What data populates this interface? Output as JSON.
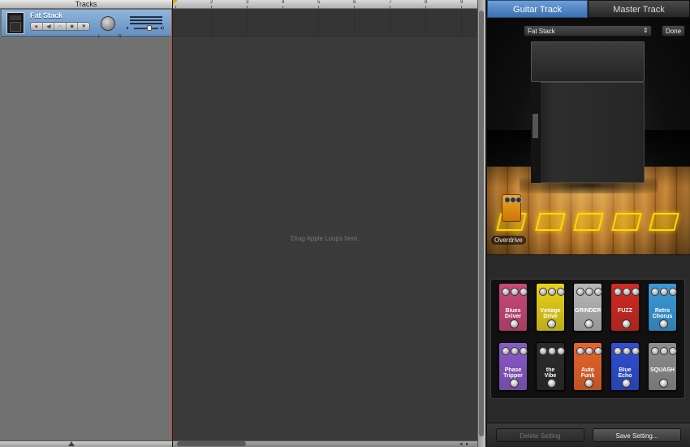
{
  "tracks": {
    "header_label": "Tracks",
    "track": {
      "name": "Fat Stack",
      "buttons": [
        "record-icon",
        "mute-icon",
        "headphones-icon",
        "lock-icon",
        "more-icon"
      ]
    }
  },
  "timeline": {
    "bar_numbers": [
      "2",
      "3",
      "4",
      "5",
      "6",
      "7",
      "8",
      "9"
    ],
    "drop_hint": "Drag Apple Loops here."
  },
  "editor": {
    "tabs": {
      "guitar": "Guitar Track",
      "master": "Master Track"
    },
    "preset": {
      "selected": "Fat Stack"
    },
    "done_label": "Done",
    "active_pedal_label": "Overdrive",
    "pedals": [
      {
        "name": "Blues\nDriver",
        "color": "#c9487a"
      },
      {
        "name": "Vintage\nDrive",
        "color": "#e8d21a"
      },
      {
        "name": "GRINDER",
        "color": "#b8b8b8"
      },
      {
        "name": "FUZZ",
        "color": "#d22a22"
      },
      {
        "name": "Retro\nChorus",
        "color": "#3a9ad8"
      },
      {
        "name": "Phase\nTripper",
        "color": "#8a5ac8"
      },
      {
        "name": "the\nVibe",
        "color": "#2b2b2b"
      },
      {
        "name": "Auto\nFunk",
        "color": "#e8642a"
      },
      {
        "name": "Blue\nEcho",
        "color": "#2e4fd4"
      },
      {
        "name": "SQUASH",
        "color": "#8e8e8e"
      }
    ],
    "buttons": {
      "delete": "Delete Setting",
      "save": "Save Setting..."
    }
  }
}
